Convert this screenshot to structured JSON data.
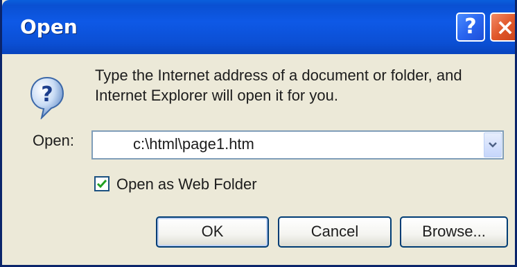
{
  "window": {
    "title": "Open",
    "help_glyph": "?",
    "close_glyph": "×",
    "title_color": "#0a50d2"
  },
  "icons": {
    "dialog_icon": "question-icon",
    "help_button": "help-icon",
    "close_button": "close-icon",
    "combo_arrow": "chevron-down-icon",
    "checkbox": "checkmark-icon"
  },
  "dialog": {
    "prompt": "Type the Internet address of a document or folder, and Internet Explorer will open it for you.",
    "open_label": "Open:",
    "open_value": "c:\\html\\page1.htm",
    "checkbox_label": "Open as Web Folder",
    "checkbox_checked": true
  },
  "buttons": {
    "ok": "OK",
    "cancel": "Cancel",
    "browse": "Browse..."
  }
}
